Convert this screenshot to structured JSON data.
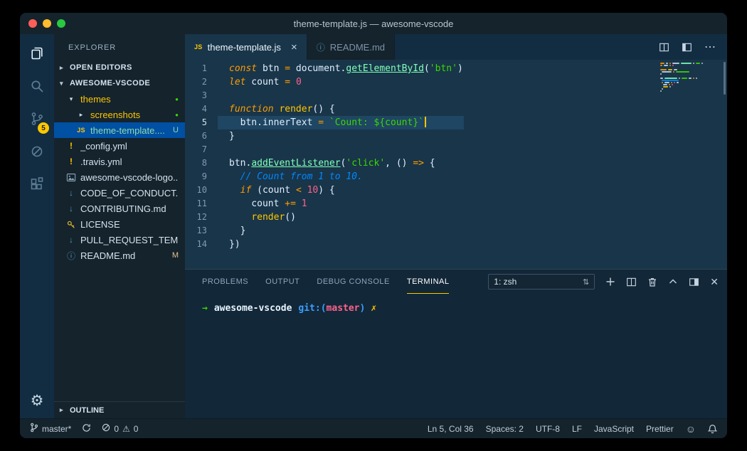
{
  "window": {
    "title": "theme-template.js — awesome-vscode"
  },
  "glyphs": {
    "js": "JS",
    "warning": "!",
    "markdown": "↓",
    "info": "ⓘ",
    "chevron_down": "▾",
    "chevron_right": "▸",
    "dot": "●",
    "gear": "⚙",
    "smiley": "☺",
    "ellipsis": "⋯",
    "close_small": "×",
    "close": "✕",
    "select_arrows": "⇅",
    "warning_triangle": "⚠"
  },
  "activity_bar": {
    "scm_badge": "5"
  },
  "sidebar": {
    "title": "EXPLORER",
    "open_editors_label": "OPEN EDITORS",
    "workspace_label": "AWESOME-VSCODE",
    "outline_label": "OUTLINE",
    "tree": [
      {
        "label": "themes",
        "icon": "chevron_down",
        "folder": true,
        "indent": 1,
        "decoration": "dot"
      },
      {
        "label": "screenshots",
        "icon": "chevron_right",
        "folder": true,
        "indent": 2,
        "decoration": "dot"
      },
      {
        "label": "theme-template....",
        "icon": "js",
        "indent": 2,
        "decoration": "U",
        "selected": true,
        "untracked": true
      },
      {
        "label": "_config.yml",
        "icon": "warning",
        "indent": 1
      },
      {
        "label": ".travis.yml",
        "icon": "warning",
        "indent": 1
      },
      {
        "label": "awesome-vscode-logo...",
        "icon": "image",
        "indent": 1
      },
      {
        "label": "CODE_OF_CONDUCT....",
        "icon": "markdown",
        "indent": 1
      },
      {
        "label": "CONTRIBUTING.md",
        "icon": "markdown",
        "indent": 1
      },
      {
        "label": "LICENSE",
        "icon": "key",
        "indent": 1
      },
      {
        "label": "PULL_REQUEST_TEMP...",
        "icon": "markdown",
        "indent": 1
      },
      {
        "label": "README.md",
        "icon": "info",
        "indent": 1,
        "decoration": "M"
      }
    ]
  },
  "editor": {
    "tabs": [
      {
        "label": "theme-template.js",
        "icon": "js",
        "active": true
      },
      {
        "label": "README.md",
        "icon": "info",
        "active": false
      }
    ],
    "code_lines": [
      {
        "n": "1",
        "tokens": [
          [
            "kw",
            "const"
          ],
          [
            "pln",
            " btn "
          ],
          [
            "op",
            "="
          ],
          [
            "pln",
            " document."
          ],
          [
            "sup",
            "getElementById"
          ],
          [
            "pln",
            "("
          ],
          [
            "str",
            "'btn'"
          ],
          [
            "pln",
            ")"
          ]
        ]
      },
      {
        "n": "2",
        "tokens": [
          [
            "kw",
            "let"
          ],
          [
            "pln",
            " count "
          ],
          [
            "op",
            "="
          ],
          [
            "pln",
            " "
          ],
          [
            "num",
            "0"
          ]
        ]
      },
      {
        "n": "3",
        "tokens": []
      },
      {
        "n": "4",
        "tokens": [
          [
            "kw",
            "function"
          ],
          [
            "pln",
            " "
          ],
          [
            "fn",
            "render"
          ],
          [
            "pln",
            "() {"
          ]
        ]
      },
      {
        "n": "5",
        "current": true,
        "cursor": true,
        "tokens": [
          [
            "pln",
            "  btn.innerText "
          ],
          [
            "op",
            "="
          ],
          [
            "pln",
            " "
          ],
          [
            "str",
            "`Count: ${count}`"
          ]
        ]
      },
      {
        "n": "6",
        "tokens": [
          [
            "pln",
            "}"
          ]
        ]
      },
      {
        "n": "7",
        "tokens": []
      },
      {
        "n": "8",
        "tokens": [
          [
            "pln",
            "btn."
          ],
          [
            "sup",
            "addEventListener"
          ],
          [
            "pln",
            "("
          ],
          [
            "str",
            "'click'"
          ],
          [
            "pln",
            ", () "
          ],
          [
            "op",
            "=>"
          ],
          [
            "pln",
            " {"
          ]
        ]
      },
      {
        "n": "9",
        "tokens": [
          [
            "cmt",
            "  // Count from 1 to 10."
          ]
        ]
      },
      {
        "n": "10",
        "tokens": [
          [
            "pln",
            "  "
          ],
          [
            "kw",
            "if"
          ],
          [
            "pln",
            " (count "
          ],
          [
            "op",
            "<"
          ],
          [
            "pln",
            " "
          ],
          [
            "num",
            "10"
          ],
          [
            "pln",
            ") {"
          ]
        ]
      },
      {
        "n": "11",
        "tokens": [
          [
            "pln",
            "    count "
          ],
          [
            "op",
            "+="
          ],
          [
            "pln",
            " "
          ],
          [
            "num",
            "1"
          ]
        ]
      },
      {
        "n": "12",
        "tokens": [
          [
            "pln",
            "    "
          ],
          [
            "fn",
            "render"
          ],
          [
            "pln",
            "()"
          ]
        ]
      },
      {
        "n": "13",
        "tokens": [
          [
            "pln",
            "  }"
          ]
        ]
      },
      {
        "n": "14",
        "tokens": [
          [
            "pln",
            "})"
          ]
        ]
      }
    ]
  },
  "panel": {
    "tabs": [
      {
        "label": "PROBLEMS"
      },
      {
        "label": "OUTPUT"
      },
      {
        "label": "DEBUG CONSOLE"
      },
      {
        "label": "TERMINAL",
        "active": true
      }
    ],
    "shell_selector": "1: zsh",
    "prompt": {
      "arrow": "→",
      "directory": "awesome-vscode",
      "git_open": "git:(",
      "branch": "master",
      "git_close": ")",
      "dirty_mark": "✗"
    }
  },
  "status_bar": {
    "branch": "master*",
    "error_count": "0",
    "warning_count": "0",
    "cursor_position": "Ln 5, Col 36",
    "indentation": "Spaces: 2",
    "encoding": "UTF-8",
    "eol": "LF",
    "language": "JavaScript",
    "formatter": "Prettier"
  }
}
